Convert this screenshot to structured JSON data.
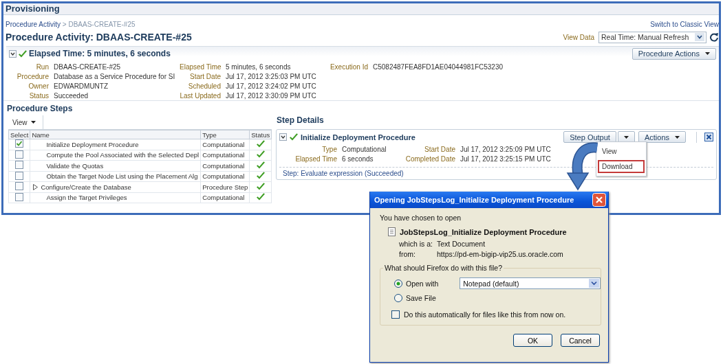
{
  "page_title": "Provisioning",
  "breadcrumb": {
    "link": "Procedure Activity",
    "separator": ">",
    "current": "DBAAS-CREATE-#25"
  },
  "switch_link": "Switch to Classic View",
  "heading": "Procedure Activity: DBAAS-CREATE-#25",
  "view_data": {
    "label": "View Data",
    "value": "Real Time: Manual Refresh"
  },
  "summary": {
    "expanded": true,
    "succeeded": true,
    "title": "Elapsed Time: 5 minutes, 6 seconds",
    "actions_button": "Procedure Actions",
    "rows": [
      [
        {
          "label": "Run",
          "value": "DBAAS-CREATE-#25"
        },
        {
          "label": "Elapsed Time",
          "value": "5 minutes, 6 seconds"
        },
        {
          "label": "Execution Id",
          "value": "C5082487FEA8FD1AE04044981FC53230"
        }
      ],
      [
        {
          "label": "Procedure",
          "value": "Database as a Service Procedure for SI"
        },
        {
          "label": "Start Date",
          "value": "Jul 17, 2012 3:25:03 PM UTC"
        }
      ],
      [
        {
          "label": "Owner",
          "value": "EDWARDMUNTZ"
        },
        {
          "label": "Scheduled",
          "value": "Jul 17, 2012 3:24:02 PM UTC"
        }
      ],
      [
        {
          "label": "Status",
          "value": "Succeeded"
        },
        {
          "label": "Last Updated",
          "value": "Jul 17, 2012 3:30:09 PM UTC"
        }
      ]
    ]
  },
  "procedure_steps": {
    "title": "Procedure Steps",
    "view_menu": "View",
    "columns": [
      "Select",
      "Name",
      "Type",
      "Status"
    ],
    "rows": [
      {
        "checked": true,
        "expandable": false,
        "name": "Initialize Deployment Procedure",
        "type": "Computational",
        "succeeded": true
      },
      {
        "checked": false,
        "expandable": false,
        "name": "Compute the Pool Associated with the Selected Depl",
        "type": "Computational",
        "succeeded": true
      },
      {
        "checked": false,
        "expandable": false,
        "name": "Validate the Quotas",
        "type": "Computational",
        "succeeded": true
      },
      {
        "checked": false,
        "expandable": false,
        "name": "Obtain the Target Node List using the Placement Alg",
        "type": "Computational",
        "succeeded": true
      },
      {
        "checked": false,
        "expandable": true,
        "name": "Configure/Create the Database",
        "type": "Procedure Step",
        "succeeded": true
      },
      {
        "checked": false,
        "expandable": false,
        "name": "Assign the Target Privileges",
        "type": "Computational",
        "succeeded": true
      }
    ]
  },
  "step_details": {
    "title": "Step Details",
    "expanded": true,
    "succeeded": true,
    "name": "Initialize Deployment Procedure",
    "step_output_button": "Step Output",
    "actions_button": "Actions",
    "rows": [
      [
        {
          "label": "Type",
          "value": "Computational"
        },
        {
          "label": "Start Date",
          "value": "Jul 17, 2012 3:25:09 PM UTC"
        }
      ],
      [
        {
          "label": "Elapsed Time",
          "value": "6 seconds"
        },
        {
          "label": "Completed Date",
          "value": "Jul 17, 2012 3:25:15 PM UTC"
        }
      ]
    ],
    "message": "Step: Evaluate expression (Succeeded)",
    "menu": [
      {
        "label": "View",
        "highlighted": false
      },
      {
        "label": "Download",
        "highlighted": true
      }
    ]
  },
  "dialog": {
    "title": "Opening JobStepsLog_Initialize Deployment Procedure",
    "intro": "You have chosen to open",
    "file_name": "JobStepsLog_Initialize Deployment Procedure",
    "info": [
      {
        "label": "which is a:",
        "value": "Text Document"
      },
      {
        "label": "from:",
        "value": "https://pd-em-bigip-vip25.us.oracle.com"
      }
    ],
    "question": "What should Firefox do with this file?",
    "options": [
      {
        "label": "Open with",
        "selected": true
      },
      {
        "label": "Save File",
        "selected": false
      }
    ],
    "app": "Notepad (default)",
    "auto": {
      "label": "Do this automatically for files like this from now on.",
      "checked": false
    },
    "buttons": [
      "OK",
      "Cancel"
    ]
  }
}
